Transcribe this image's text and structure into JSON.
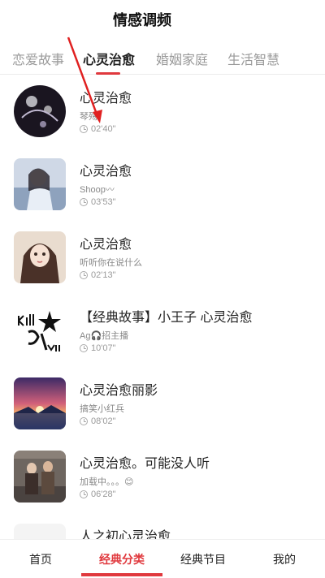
{
  "header": {
    "title": "情感调频"
  },
  "tabs": [
    {
      "label": "恋爱故事",
      "active": false
    },
    {
      "label": "心灵治愈",
      "active": true
    },
    {
      "label": "婚姻家庭",
      "active": false
    },
    {
      "label": "生活智慧",
      "active": false
    }
  ],
  "items": [
    {
      "title": "心灵治愈",
      "subtitle": "琴殇",
      "duration": "02'40\""
    },
    {
      "title": "心灵治愈",
      "subtitle": "Shoop〰",
      "duration": "03'53\""
    },
    {
      "title": "心灵治愈",
      "subtitle": "听听你在说什么",
      "duration": "02'13\""
    },
    {
      "title": "【经典故事】小王子 心灵治愈",
      "subtitle": "Ag🎧招主播",
      "duration": "10'07\""
    },
    {
      "title": "心灵治愈丽影",
      "subtitle": "搞笑小红兵",
      "duration": "08'02\""
    },
    {
      "title": "心灵治愈。可能没人听",
      "subtitle": "加载中。。。😊",
      "duration": "06'28\""
    },
    {
      "title": "人之初心灵治愈",
      "subtitle": "",
      "duration": ""
    }
  ],
  "bottom_nav": [
    {
      "label": "首页",
      "active": false
    },
    {
      "label": "经典分类",
      "active": true
    },
    {
      "label": "经典节目",
      "active": false
    },
    {
      "label": "我的",
      "active": false
    }
  ],
  "colors": {
    "accent": "#e0393e",
    "annotation_arrow": "#e02020"
  }
}
